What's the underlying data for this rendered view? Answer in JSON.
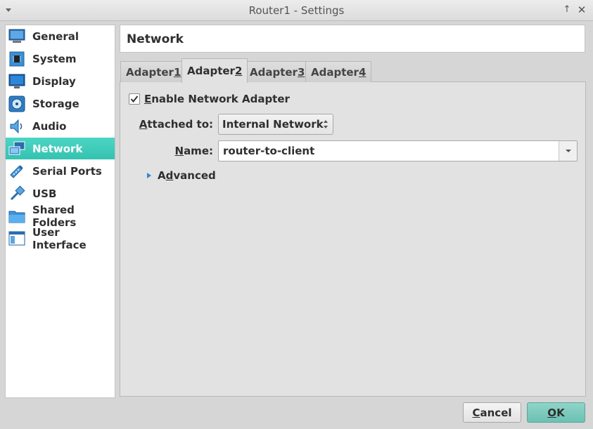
{
  "window": {
    "title": "Router1 - Settings",
    "pin_glyph": "↑",
    "close_glyph": "✕"
  },
  "sidebar": {
    "items": [
      {
        "label": "General",
        "icon": "general-icon"
      },
      {
        "label": "System",
        "icon": "system-icon"
      },
      {
        "label": "Display",
        "icon": "display-icon"
      },
      {
        "label": "Storage",
        "icon": "storage-icon"
      },
      {
        "label": "Audio",
        "icon": "audio-icon"
      },
      {
        "label": "Network",
        "icon": "network-icon",
        "active": true
      },
      {
        "label": "Serial Ports",
        "icon": "serial-ports-icon"
      },
      {
        "label": "USB",
        "icon": "usb-icon"
      },
      {
        "label": "Shared Folders",
        "icon": "shared-folders-icon"
      },
      {
        "label": "User Interface",
        "icon": "user-interface-icon"
      }
    ]
  },
  "main": {
    "title": "Network",
    "tabs": [
      {
        "label": "Adapter ",
        "key": "1"
      },
      {
        "label": "Adapter ",
        "key": "2",
        "active": true
      },
      {
        "label": "Adapter ",
        "key": "3"
      },
      {
        "label": "Adapter ",
        "key": "4"
      }
    ],
    "enable_adapter": {
      "key": "E",
      "rest": "nable Network Adapter",
      "checked": true
    },
    "attached_to": {
      "key": "A",
      "rest": "ttached to:",
      "value": "Internal Network"
    },
    "name": {
      "key": "N",
      "rest": "ame:",
      "value": "router-to-client"
    },
    "advanced": {
      "pre": "A",
      "key": "d",
      "rest": "vanced"
    }
  },
  "footer": {
    "cancel": {
      "key": "C",
      "rest": "ancel"
    },
    "ok": {
      "key": "O",
      "rest": "K"
    }
  },
  "colors": {
    "accent": "#3ccab8",
    "ok_button": "#7ccabd"
  }
}
